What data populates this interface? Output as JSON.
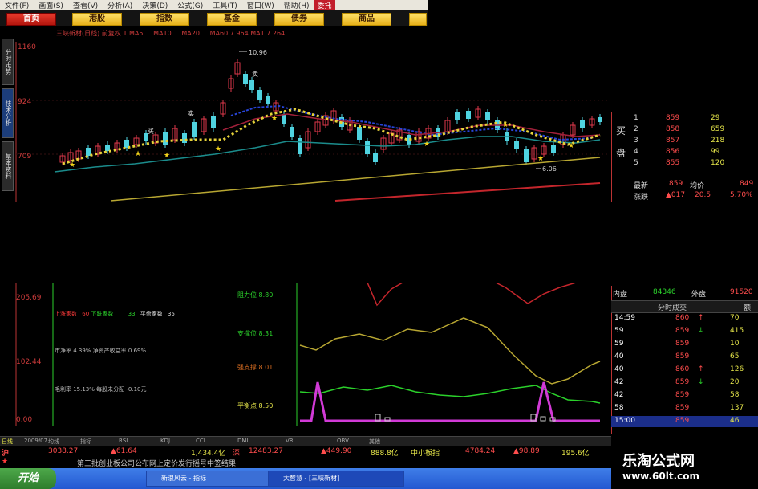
{
  "menu": [
    "文件(F)",
    "画面(S)",
    "查看(V)",
    "分析(A)",
    "决策(D)",
    "公式(G)",
    "工具(T)",
    "窗口(W)",
    "帮助(H)",
    "委托"
  ],
  "toolbar": [
    "首页",
    "港股",
    "指数",
    "基金",
    "债券",
    "商品",
    ""
  ],
  "header_text": "三峡新材(日线)  前复权  1    MA5 ...  MA10 ...  MA20 ...  MA60 7.964  MA1 7.264 ...",
  "left_tabs": [
    "分时走势",
    "技术分析",
    "基本资料"
  ],
  "main_chart": {
    "y_labels": [
      "1160",
      "924",
      "709"
    ],
    "annotations": {
      "high": "10.96",
      "low": "6.06",
      "buy": "买",
      "sell": "卖"
    }
  },
  "book": {
    "side_labels": {
      "buy": "买",
      "sell": "盘"
    },
    "rows": [
      {
        "n": "1",
        "p": "859",
        "v": "29"
      },
      {
        "n": "2",
        "p": "858",
        "v": "659"
      },
      {
        "n": "3",
        "p": "857",
        "v": "218"
      },
      {
        "n": "4",
        "p": "856",
        "v": "99"
      },
      {
        "n": "5",
        "p": "855",
        "v": "120"
      }
    ],
    "latest_label": "最新",
    "latest_value": "859",
    "avg_label": "均价",
    "avg_value": "849",
    "change_label": "涨跌",
    "change_value": "▲017",
    "change2": "20.5",
    "pct": "5.70%"
  },
  "lower": {
    "y_labels": [
      "205.69",
      "102.44",
      "0.00"
    ],
    "counts": {
      "up_label": "上涨家数",
      "up": "60",
      "down_label": "下跌家数",
      "down": "33",
      "flat_label": "平盘家数",
      "flat": "35"
    },
    "info": [
      "市净率  4.39%   净资产收益率  0.69%",
      "毛利率  15.13%   每股未分配  -0.10元"
    ],
    "indicators": [
      {
        "label": "阻力位",
        "value": "8.80",
        "color": "#2bd12b"
      },
      {
        "label": "支撑位",
        "value": "8.31",
        "color": "#2bd12b"
      },
      {
        "label": "强支撑",
        "value": "8.01",
        "color": "#d46b21"
      },
      {
        "label": "平衡点",
        "value": "8.50",
        "color": "#e6e64a"
      }
    ]
  },
  "ticks": {
    "inner_label": "内盘",
    "inner_value": "84346",
    "outer_label": "外盘",
    "outer_value": "91520",
    "header": "分时成交",
    "header_right": "额",
    "rows": [
      {
        "t": "14:59",
        "p": "860",
        "a": "↑",
        "v": "70"
      },
      {
        "t": "59",
        "p": "859",
        "a": "↓",
        "v": "415"
      },
      {
        "t": "59",
        "p": "859",
        "a": "",
        "v": "10"
      },
      {
        "t": "40",
        "p": "859",
        "a": "",
        "v": "65"
      },
      {
        "t": "40",
        "p": "860",
        "a": "↑",
        "v": "126"
      },
      {
        "t": "42",
        "p": "859",
        "a": "↓",
        "v": "20"
      },
      {
        "t": "42",
        "p": "859",
        "a": "",
        "v": "58"
      },
      {
        "t": "58",
        "p": "859",
        "a": "",
        "v": "137"
      },
      {
        "t": "15:00",
        "p": "859",
        "a": "",
        "v": "46"
      }
    ]
  },
  "bottom_tabs": [
    "日线",
    "2009/07",
    "均线",
    "指标",
    "RSI",
    "KDJ",
    "CCI",
    "DMI",
    "VR",
    "OBV",
    "其他"
  ],
  "index_bar": {
    "sh_label": "沪",
    "sh_value": "3038.27",
    "sh_change": "▲61.64",
    "sh_amount": "1,434.4亿",
    "sz_label": "深",
    "sz_value": "12483.27",
    "sz_change": "▲449.90",
    "sz_amount": "888.8亿",
    "small_label": "中小板指",
    "small_value": "4784.24",
    "small_change": "▲98.89",
    "small_amount": "195.6亿"
  },
  "news": "第三批创业板公司公布网上定价发行摇号中签结果",
  "taskbar": {
    "start": "开始",
    "tasks": [
      "新浪风云 - 指标",
      "大智慧 - [三峡新材]"
    ]
  },
  "watermark": {
    "title": "乐淘公式网",
    "url": "www.60lt.com"
  }
}
